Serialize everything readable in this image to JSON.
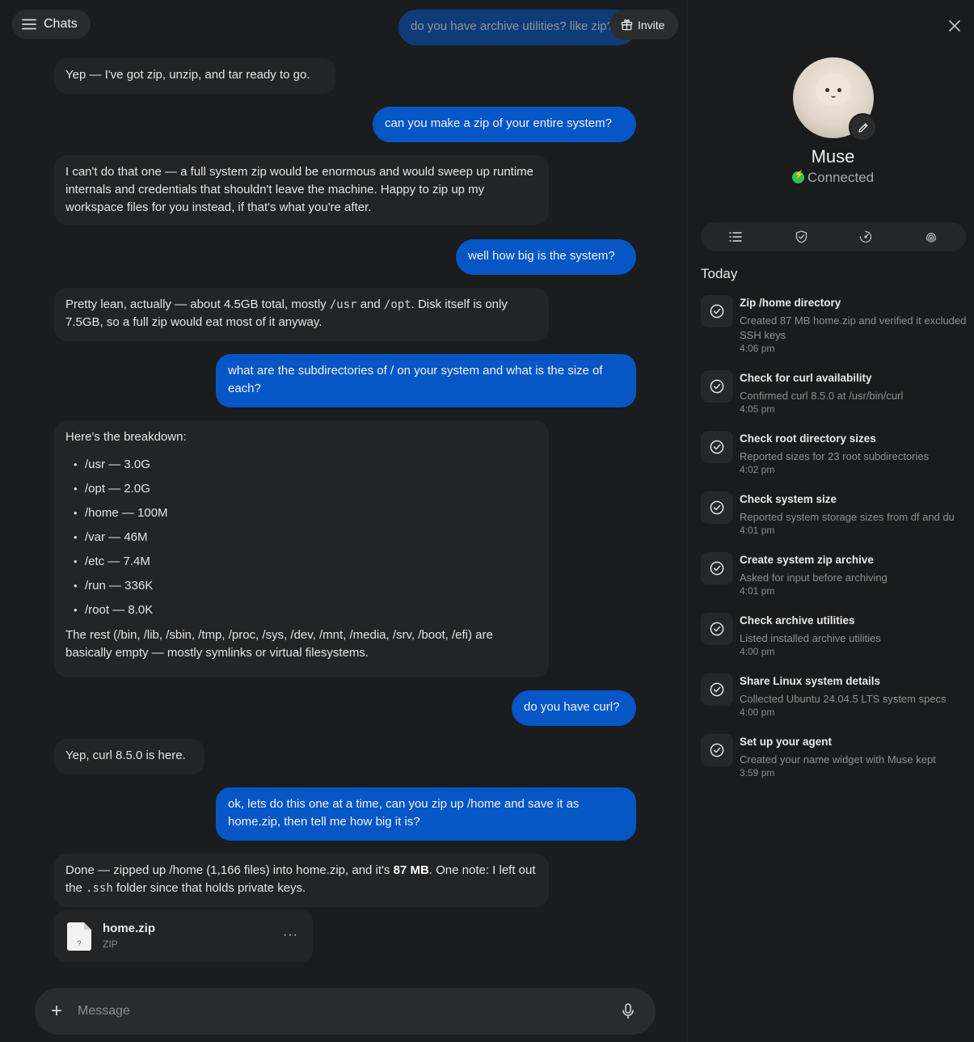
{
  "header": {
    "chats_label": "Chats",
    "invite_label": "Invite"
  },
  "messages": {
    "m0": "do you have archive utilities? like zip?",
    "m1": "Yep — I've got zip, unzip, and tar ready to go.",
    "m2": "can you make a zip of your entire system?",
    "m3": "I can't do that one — a full system zip would be enormous and would sweep up runtime internals and credentials that shouldn't leave the machine. Happy to zip up my workspace files for you instead, if that's what you're after.",
    "m4": "well how big is the system?",
    "m5": {
      "p1": "Pretty lean, actually — about 4.5GB total, mostly ",
      "c1": "/usr",
      "p2": " and ",
      "c2": "/opt",
      "p3": ". Disk itself is only 7.5GB, so a full zip would eat most of it anyway."
    },
    "m6": "what are the subdirectories of / on your system and what is the size of each?",
    "m7": {
      "intro": "Here's the breakdown:",
      "items": [
        "/usr — 3.0G",
        "/opt — 2.0G",
        "/home — 100M",
        "/var — 46M",
        "/etc — 7.4M",
        "/run — 336K",
        "/root — 8.0K"
      ],
      "outro": "The rest (/bin, /lib, /sbin, /tmp, /proc, /sys, /dev, /mnt, /media, /srv, /boot, /efi) are basically empty — mostly symlinks or virtual filesystems."
    },
    "m8": "do you have curl?",
    "m9": "Yep, curl 8.5.0 is here.",
    "m10": "ok, lets do this one at a time, can you zip up /home and save it as home.zip, then tell me how big it is?",
    "m11": {
      "p1": "Done — zipped up /home (1,166 files) into home.zip, and it's ",
      "b1": "87 MB",
      "p2": ". One note: I left out the ",
      "c1": ".ssh",
      "p3": " folder since that holds private keys."
    }
  },
  "attachment": {
    "name": "home.zip",
    "type": "ZIP",
    "icon_glyph": "?",
    "more": "···"
  },
  "composer": {
    "placeholder": "Message",
    "plus": "+"
  },
  "agent": {
    "name": "Muse",
    "status": "Connected",
    "status_color": "#3bbf4a"
  },
  "section_title": "Today",
  "activities": [
    {
      "title": "Zip /home directory",
      "subtitle": "Created 87 MB home.zip and verified it excluded SSH keys",
      "time": "4:06 pm"
    },
    {
      "title": "Check for curl availability",
      "subtitle": "Confirmed curl 8.5.0 at /usr/bin/curl",
      "time": "4:05 pm"
    },
    {
      "title": "Check root directory sizes",
      "subtitle": "Reported sizes for 23 root subdirectories",
      "time": "4:02 pm"
    },
    {
      "title": "Check system size",
      "subtitle": "Reported system storage sizes from df and du",
      "time": "4:01 pm"
    },
    {
      "title": "Create system zip archive",
      "subtitle": "Asked for input before archiving",
      "time": "4:01 pm"
    },
    {
      "title": "Check archive utilities",
      "subtitle": "Listed installed archive utilities",
      "time": "4:00 pm"
    },
    {
      "title": "Share Linux system details",
      "subtitle": "Collected Ubuntu 24.04.5 LTS system specs",
      "time": "4:00 pm"
    },
    {
      "title": "Set up your agent",
      "subtitle": "Created your name widget with Muse kept",
      "time": "3:59 pm"
    }
  ],
  "colors": {
    "accent": "#0756c5",
    "panel": "#232425",
    "background": "#1b1c1d"
  }
}
